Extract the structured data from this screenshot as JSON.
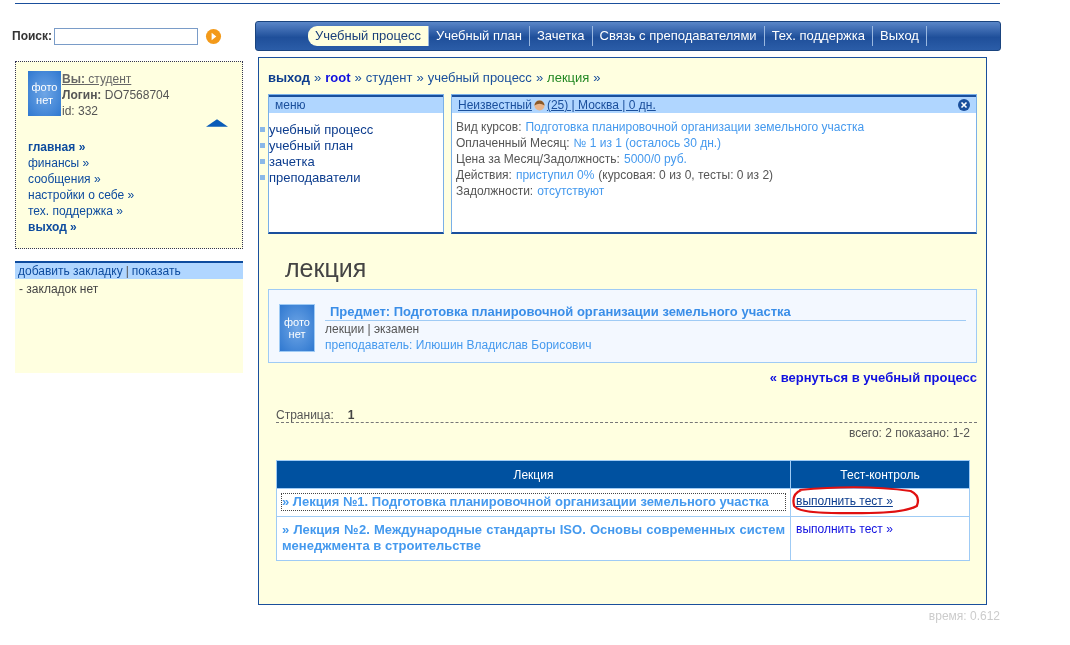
{
  "search": {
    "label": "Поиск:"
  },
  "nav": {
    "tabs": [
      {
        "label": "Учебный процесс",
        "selected": true
      },
      {
        "label": "Учебный план",
        "selected": false
      },
      {
        "label": "Зачетка",
        "selected": false
      },
      {
        "label": "Связь с преподавателями",
        "selected": false
      },
      {
        "label": "Тех. поддержка",
        "selected": false
      },
      {
        "label": "Выход",
        "selected": false
      }
    ]
  },
  "profile": {
    "photo_text": "фото нет",
    "you_label": "Вы:",
    "you_value": "студент",
    "login_label": "Логин:",
    "login_value": "DO7568704",
    "id": "id: 332"
  },
  "sidebar": {
    "items": [
      {
        "label": "главная »",
        "bold": true
      },
      {
        "label": "финансы »",
        "bold": false
      },
      {
        "label": "сообщения »",
        "bold": false
      },
      {
        "label": "настройки о себе »",
        "bold": false
      },
      {
        "label": "тех. поддержка »",
        "bold": false
      },
      {
        "label": "выход »",
        "bold": true
      }
    ]
  },
  "bookmarks": {
    "links": [
      "добавить закладку",
      "показать"
    ],
    "separator": "|",
    "empty": "- закладок нет"
  },
  "breadcrumb": {
    "separator": "»",
    "items": [
      {
        "label": "выход",
        "kind": "bold"
      },
      {
        "label": "root",
        "kind": "strong"
      },
      {
        "label": "студент",
        "kind": "plain"
      },
      {
        "label": "учебный процесс",
        "kind": "plain"
      },
      {
        "label": "лекция",
        "kind": "current"
      }
    ]
  },
  "menu": {
    "title": "меню",
    "items": [
      "учебный процесс",
      "учебный план",
      "зачетка",
      "преподаватели"
    ]
  },
  "info": {
    "name": "Неизвестный",
    "details": "(25) | Москва | 0 дн.",
    "rows": [
      {
        "label": "Вид курсов:",
        "value": "Подготовка планировочной организации земельного участка"
      },
      {
        "label": "Оплаченный Месяц:",
        "value": "№ 1 из 1 (осталось 30 дн.)"
      },
      {
        "label": "Цена за Месяц/Задолжность:",
        "value": "5000/0 руб."
      },
      {
        "label": "Действия:",
        "value": "приступил 0%",
        "note": "(курсовая: 0 из 0, тесты: 0 из 2)"
      },
      {
        "label": "Задолжности:",
        "value": "отсутствуют"
      }
    ]
  },
  "heading": "лекция",
  "subject": {
    "photo_text": "фото нет",
    "title": "Предмет: Подготовка планировочной организации земельного участка",
    "links": "лекции | экзамен",
    "teacher": "преподаватель: Илюшин Владислав Борисович"
  },
  "back_link": "« вернуться в учебный процесс",
  "pager": {
    "label": "Страница:",
    "page": "1",
    "total": "всего: 2 показано: 1-2"
  },
  "table": {
    "columns": [
      "Лекция",
      "Тест-контроль"
    ],
    "rows": [
      {
        "lecture": "» Лекция №1. Подготовка планировочной организации земельного участка",
        "test": "выполнить тест »",
        "focused": true,
        "circled": true
      },
      {
        "lecture": "» Лекция №2. Международные стандарты ISO. Основы современных систем менеджмента в строительстве",
        "test": "выполнить тест »",
        "focused": false,
        "circled": false
      }
    ]
  },
  "footer": "время: 0.612"
}
